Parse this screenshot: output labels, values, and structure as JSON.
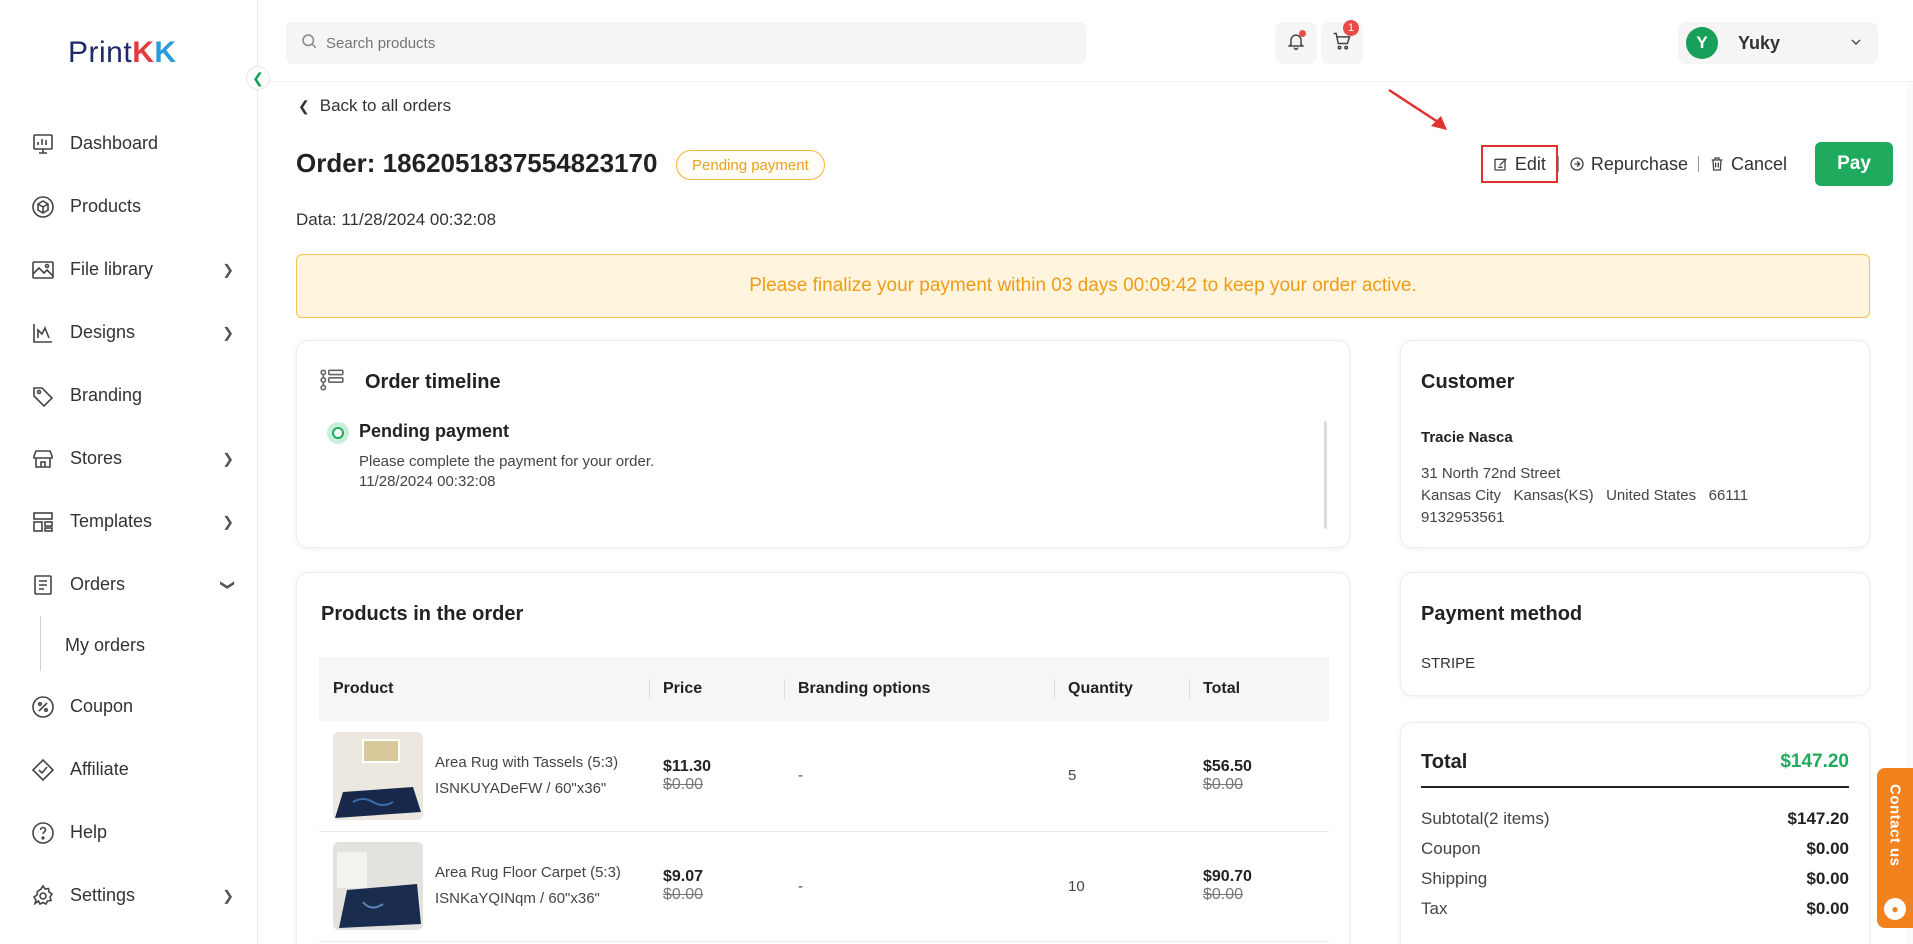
{
  "brand": {
    "logo_prefix": "Print",
    "logo_k1": "K",
    "logo_k2": "K"
  },
  "sidebar": {
    "items": [
      {
        "label": "Dashboard",
        "icon": "dashboard-icon",
        "has_chevron": false
      },
      {
        "label": "Products",
        "icon": "box-icon",
        "has_chevron": false
      },
      {
        "label": "File library",
        "icon": "image-icon",
        "has_chevron": true
      },
      {
        "label": "Designs",
        "icon": "design-icon",
        "has_chevron": true
      },
      {
        "label": "Branding",
        "icon": "tag-icon",
        "has_chevron": false
      },
      {
        "label": "Stores",
        "icon": "store-icon",
        "has_chevron": true
      },
      {
        "label": "Templates",
        "icon": "template-icon",
        "has_chevron": true
      },
      {
        "label": "Orders",
        "icon": "orders-icon",
        "has_chevron": true
      },
      {
        "label": "My orders"
      },
      {
        "label": "Coupon",
        "icon": "coupon-icon"
      },
      {
        "label": "Affiliate",
        "icon": "affiliate-icon"
      },
      {
        "label": "Help",
        "icon": "help-icon"
      },
      {
        "label": "Settings",
        "icon": "settings-icon",
        "has_chevron": true
      }
    ]
  },
  "header": {
    "search_placeholder": "Search products",
    "cart_count": "1",
    "user_initial": "Y",
    "user_name": "Yuky"
  },
  "order": {
    "back_label": "Back to all orders",
    "title": "Order: 1862051837554823170",
    "status": "Pending payment",
    "date": "Data: 11/28/2024 00:32:08",
    "actions": {
      "edit": "Edit",
      "repurchase": "Repurchase",
      "cancel": "Cancel",
      "pay": "Pay"
    },
    "banner": "Please finalize your payment within 03 days 00:09:42 to keep your order active."
  },
  "timeline": {
    "title": "Order timeline",
    "status": "Pending payment",
    "description": "Please complete the payment for your order.",
    "time": "11/28/2024 00:32:08"
  },
  "products": {
    "title": "Products in the order",
    "columns": [
      "Product",
      "Price",
      "Branding options",
      "Quantity",
      "Total"
    ],
    "rows": [
      {
        "name": "Area Rug with Tassels (5:3)",
        "sku": "ISNKUYADeFW / 60\"x36\"",
        "price": "$11.30",
        "price_old": "$0.00",
        "branding": "-",
        "quantity": "5",
        "total": "$56.50",
        "total_old": "$0.00"
      },
      {
        "name": "Area Rug Floor Carpet (5:3)",
        "sku": "ISNKaYQINqm / 60\"x36\"",
        "price": "$9.07",
        "price_old": "$0.00",
        "branding": "-",
        "quantity": "10",
        "total": "$90.70",
        "total_old": "$0.00"
      }
    ]
  },
  "customer": {
    "title": "Customer",
    "name": "Tracie Nasca",
    "street": "31 North 72nd Street",
    "city_line": "Kansas City   Kansas(KS)   United States   66111",
    "phone": "9132953561"
  },
  "payment": {
    "title": "Payment method",
    "method": "STRIPE"
  },
  "total": {
    "title": "Total",
    "amount": "$147.20",
    "rows": [
      {
        "label": "Subtotal(2 items)",
        "value": "$147.20"
      },
      {
        "label": "Coupon",
        "value": "$0.00"
      },
      {
        "label": "Shipping",
        "value": "$0.00"
      },
      {
        "label": "Tax",
        "value": "$0.00"
      }
    ]
  },
  "contact_label": "Contact us",
  "colors": {
    "accent": "#1faa5e",
    "warning": "#ef9c18",
    "annotation": "#e13232",
    "contact": "#f2821e"
  }
}
